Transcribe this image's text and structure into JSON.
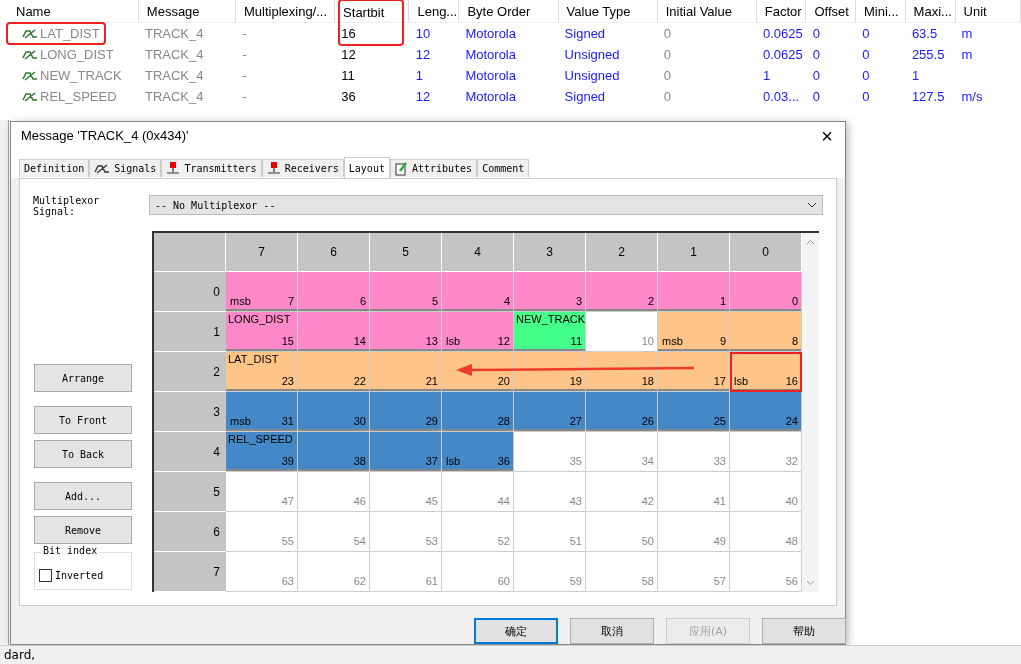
{
  "signal_table": {
    "columns": [
      {
        "label": "Name",
        "highlighted": false
      },
      {
        "label": "Message",
        "highlighted": false
      },
      {
        "label": "Multiplexing/...",
        "highlighted": false
      },
      {
        "label": "Startbit",
        "highlighted": true
      },
      {
        "label": "Leng...",
        "highlighted": false
      },
      {
        "label": "Byte Order",
        "highlighted": false
      },
      {
        "label": "Value Type",
        "highlighted": false
      },
      {
        "label": "Initial Value",
        "highlighted": false
      },
      {
        "label": "Factor",
        "highlighted": false
      },
      {
        "label": "Offset",
        "highlighted": false
      },
      {
        "label": "Mini...",
        "highlighted": false
      },
      {
        "label": "Maxi...",
        "highlighted": false
      },
      {
        "label": "Unit",
        "highlighted": false
      }
    ],
    "rows": [
      {
        "highlighted": true,
        "cells": [
          "LAT_DIST",
          "TRACK_4",
          "-",
          "16",
          "10",
          "Motorola",
          "Signed",
          "0",
          "0.0625",
          "0",
          "0",
          "63.5",
          "m"
        ]
      },
      {
        "highlighted": false,
        "cells": [
          "LONG_DIST",
          "TRACK_4",
          "-",
          "12",
          "12",
          "Motorola",
          "Unsigned",
          "0",
          "0.0625",
          "0",
          "0",
          "255.5",
          "m"
        ]
      },
      {
        "highlighted": false,
        "cells": [
          "NEW_TRACK",
          "TRACK_4",
          "-",
          "11",
          "1",
          "Motorola",
          "Unsigned",
          "0",
          "1",
          "0",
          "0",
          "1",
          ""
        ]
      },
      {
        "highlighted": false,
        "cells": [
          "REL_SPEED",
          "TRACK_4",
          "-",
          "36",
          "12",
          "Motorola",
          "Signed",
          "0",
          "0.03...",
          "0",
          "0",
          "127.5",
          "m/s"
        ]
      }
    ]
  },
  "dialog": {
    "title": "Message 'TRACK_4 (0x434)'",
    "close": "×",
    "tabs": [
      {
        "label": "Definition",
        "kind": "plain",
        "selected": false
      },
      {
        "label": "Signals",
        "kind": "signal",
        "selected": false
      },
      {
        "label": "Transmitters",
        "kind": "node",
        "selected": false
      },
      {
        "label": "Receivers",
        "kind": "node",
        "selected": false
      },
      {
        "label": "Layout",
        "kind": "plain",
        "selected": true
      },
      {
        "label": "Attributes",
        "kind": "pencil",
        "selected": false
      },
      {
        "label": "Comment",
        "kind": "plain",
        "selected": false
      }
    ],
    "multiplexor": {
      "label": "Multiplexor Signal:",
      "value": "-- No Multiplexor --"
    },
    "side_buttons": [
      "Arrange",
      "To Front",
      "To Back",
      "Add...",
      "Remove"
    ],
    "bit_index": {
      "title": "Bit index",
      "label": "Inverted",
      "checked": false
    },
    "grid": {
      "columns": [
        "7",
        "6",
        "5",
        "4",
        "3",
        "2",
        "1",
        "0"
      ],
      "rows": [
        {
          "label": "0",
          "cells": [
            {
              "bit": "7",
              "color": "#ff88c8",
              "note": "msb"
            },
            {
              "bit": "6",
              "color": "#ff88c8"
            },
            {
              "bit": "5",
              "color": "#ff88c8"
            },
            {
              "bit": "4",
              "color": "#ff88c8"
            },
            {
              "bit": "3",
              "color": "#ff88c8"
            },
            {
              "bit": "2",
              "color": "#ff88c8"
            },
            {
              "bit": "1",
              "color": "#ff88c8"
            },
            {
              "bit": "0",
              "color": "#ff88c8"
            }
          ]
        },
        {
          "label": "1",
          "cells": [
            {
              "bit": "15",
              "color": "#ff88c8",
              "name": "LONG_DIST"
            },
            {
              "bit": "14",
              "color": "#ff88c8"
            },
            {
              "bit": "13",
              "color": "#ff88c8"
            },
            {
              "bit": "12",
              "color": "#ff88c8",
              "note": "lsb"
            },
            {
              "bit": "11",
              "color": "#44ff88",
              "name": "NEW_TRACK"
            },
            {
              "bit": "10",
              "color": "#ffffff"
            },
            {
              "bit": "9",
              "color": "#ffc488",
              "note": "msb"
            },
            {
              "bit": "8",
              "color": "#ffc488"
            }
          ]
        },
        {
          "label": "2",
          "cells": [
            {
              "bit": "23",
              "color": "#ffc488",
              "name": "LAT_DIST"
            },
            {
              "bit": "22",
              "color": "#ffc488"
            },
            {
              "bit": "21",
              "color": "#ffc488"
            },
            {
              "bit": "20",
              "color": "#ffc488"
            },
            {
              "bit": "19",
              "color": "#ffc488"
            },
            {
              "bit": "18",
              "color": "#ffc488"
            },
            {
              "bit": "17",
              "color": "#ffc488"
            },
            {
              "bit": "16",
              "color": "#ffc488",
              "note": "lsb",
              "highlighted": true
            }
          ]
        },
        {
          "label": "3",
          "cells": [
            {
              "bit": "31",
              "color": "#4488c8",
              "note": "msb"
            },
            {
              "bit": "30",
              "color": "#4488c8"
            },
            {
              "bit": "29",
              "color": "#4488c8"
            },
            {
              "bit": "28",
              "color": "#4488c8"
            },
            {
              "bit": "27",
              "color": "#4488c8"
            },
            {
              "bit": "26",
              "color": "#4488c8"
            },
            {
              "bit": "25",
              "color": "#4488c8"
            },
            {
              "bit": "24",
              "color": "#4488c8"
            }
          ]
        },
        {
          "label": "4",
          "cells": [
            {
              "bit": "39",
              "color": "#4488c8",
              "name": "REL_SPEED"
            },
            {
              "bit": "38",
              "color": "#4488c8"
            },
            {
              "bit": "37",
              "color": "#4488c8"
            },
            {
              "bit": "36",
              "color": "#4488c8",
              "note": "lsb"
            },
            {
              "bit": "35",
              "color": "#ffffff"
            },
            {
              "bit": "34",
              "color": "#ffffff"
            },
            {
              "bit": "33",
              "color": "#ffffff"
            },
            {
              "bit": "32",
              "color": "#ffffff"
            }
          ]
        },
        {
          "label": "5",
          "cells": [
            {
              "bit": "47",
              "color": "#ffffff"
            },
            {
              "bit": "46",
              "color": "#ffffff"
            },
            {
              "bit": "45",
              "color": "#ffffff"
            },
            {
              "bit": "44",
              "color": "#ffffff"
            },
            {
              "bit": "43",
              "color": "#ffffff"
            },
            {
              "bit": "42",
              "color": "#ffffff"
            },
            {
              "bit": "41",
              "color": "#ffffff"
            },
            {
              "bit": "40",
              "color": "#ffffff"
            }
          ]
        },
        {
          "label": "6",
          "cells": [
            {
              "bit": "55",
              "color": "#ffffff"
            },
            {
              "bit": "54",
              "color": "#ffffff"
            },
            {
              "bit": "53",
              "color": "#ffffff"
            },
            {
              "bit": "52",
              "color": "#ffffff"
            },
            {
              "bit": "51",
              "color": "#ffffff"
            },
            {
              "bit": "50",
              "color": "#ffffff"
            },
            {
              "bit": "49",
              "color": "#ffffff"
            },
            {
              "bit": "48",
              "color": "#ffffff"
            }
          ]
        },
        {
          "label": "7",
          "cells": [
            {
              "bit": "63",
              "color": "#ffffff"
            },
            {
              "bit": "62",
              "color": "#ffffff"
            },
            {
              "bit": "61",
              "color": "#ffffff"
            },
            {
              "bit": "60",
              "color": "#ffffff"
            },
            {
              "bit": "59",
              "color": "#ffffff"
            },
            {
              "bit": "58",
              "color": "#ffffff"
            },
            {
              "bit": "57",
              "color": "#ffffff"
            },
            {
              "bit": "56",
              "color": "#ffffff"
            }
          ]
        }
      ]
    },
    "buttons": [
      {
        "label": "确定",
        "default": true,
        "disabled": false
      },
      {
        "label": "取消",
        "default": false,
        "disabled": false
      },
      {
        "label": "应用(A)",
        "default": false,
        "disabled": true
      },
      {
        "label": "帮助",
        "default": false,
        "disabled": false
      }
    ]
  },
  "status_bar": {
    "text": "dard,"
  }
}
